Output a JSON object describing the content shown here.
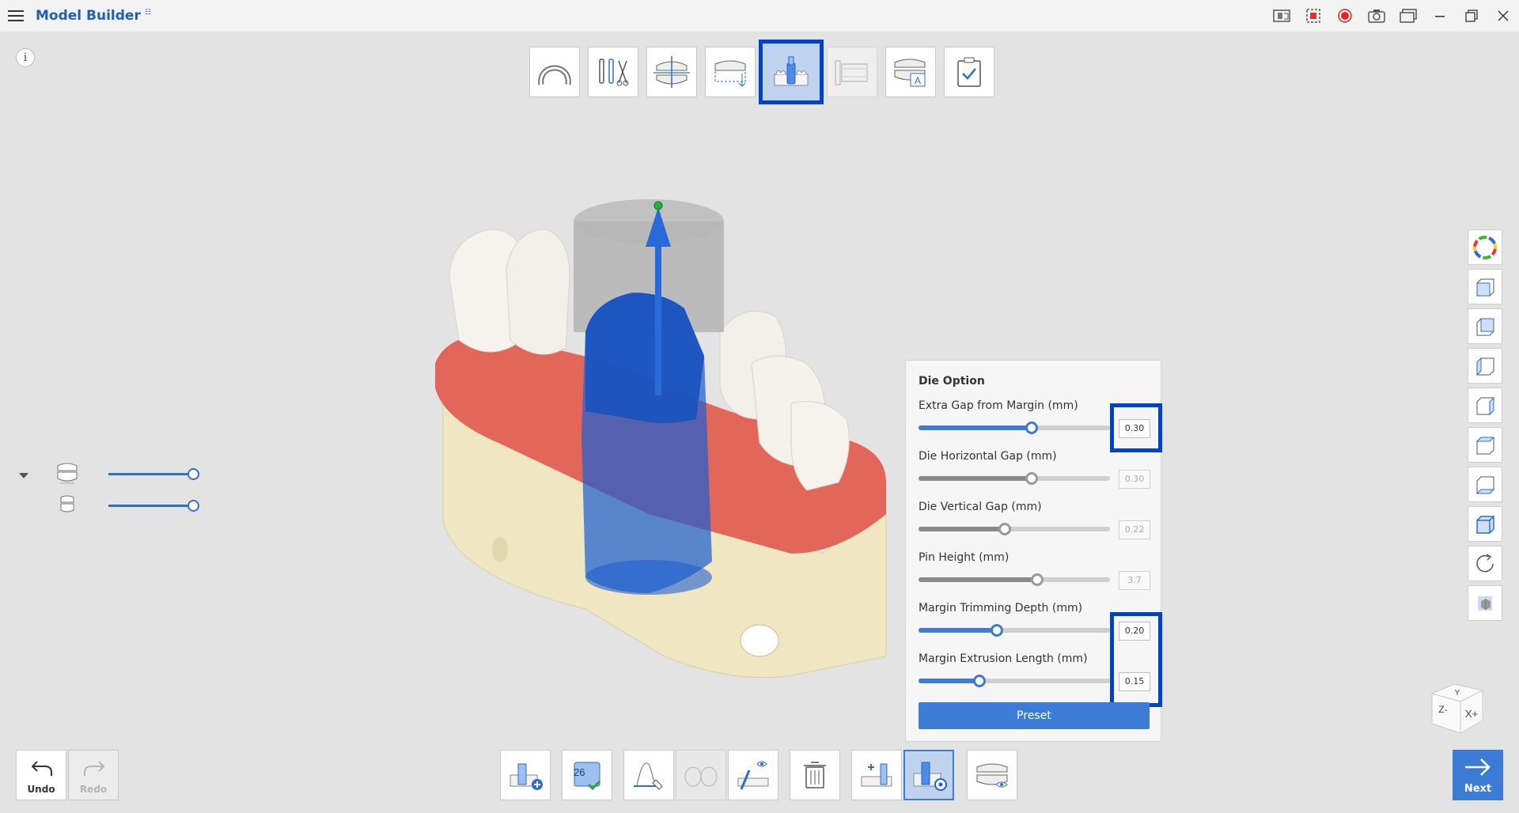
{
  "app": {
    "title": "Model Builder",
    "title_mark": "☷"
  },
  "die_panel": {
    "title": "Die Option",
    "options": [
      {
        "label": "Extra Gap from Margin (mm)",
        "value": "0.30",
        "level": 0.59,
        "enabled": true
      },
      {
        "label": "Die Horizontal Gap (mm)",
        "value": "0.30",
        "level": 0.59,
        "enabled": false
      },
      {
        "label": "Die Vertical Gap (mm)",
        "value": "0.22",
        "level": 0.45,
        "enabled": false
      },
      {
        "label": "Pin Height (mm)",
        "value": "3.7",
        "level": 0.62,
        "enabled": false
      },
      {
        "label": "Margin Trimming Depth (mm)",
        "value": "0.20",
        "level": 0.41,
        "enabled": true
      },
      {
        "label": "Margin Extrusion Length (mm)",
        "value": "0.15",
        "level": 0.32,
        "enabled": true
      }
    ],
    "preset_label": "Preset"
  },
  "bottom": {
    "undo_label": "Undo",
    "redo_label": "Redo",
    "next_label": "Next",
    "tooth_number": "26"
  },
  "visibility": {
    "upper_level": 1.0,
    "lower_level": 1.0
  },
  "colors": {
    "accent": "#3d7cd6",
    "highlight": "#0043c9",
    "die_blue": "#1f5fd0",
    "gum": "#e2665a",
    "base": "#f0e6c2"
  }
}
